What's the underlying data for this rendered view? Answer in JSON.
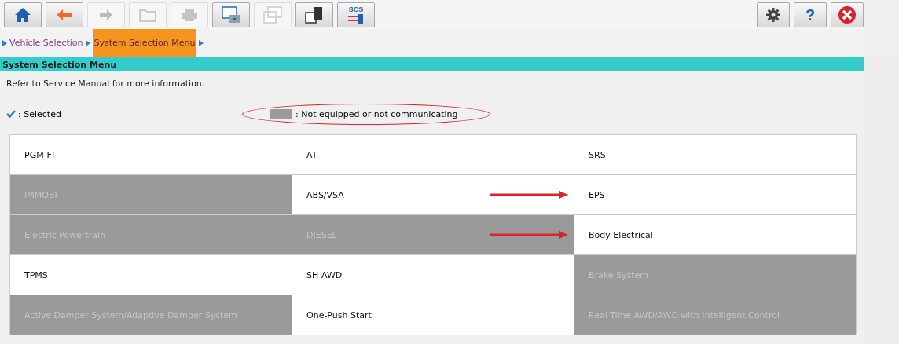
{
  "toolbar": {
    "left": [
      {
        "kind": "home",
        "disabled": false
      },
      {
        "kind": "back",
        "disabled": false
      },
      {
        "kind": "forward",
        "disabled": true
      },
      {
        "kind": "folder",
        "disabled": true
      },
      {
        "kind": "print",
        "disabled": true
      },
      {
        "kind": "screen",
        "disabled": false
      },
      {
        "kind": "window",
        "disabled": true
      },
      {
        "kind": "copy",
        "disabled": false
      },
      {
        "kind": "scs",
        "disabled": false,
        "label": "SCS"
      }
    ],
    "right": [
      {
        "kind": "settings"
      },
      {
        "kind": "help",
        "label": "?"
      },
      {
        "kind": "close"
      }
    ]
  },
  "breadcrumb": [
    {
      "label": "Vehicle Selection",
      "selected": false
    },
    {
      "label": "System Selection Menu",
      "selected": true
    }
  ],
  "section": {
    "title": "System Selection Menu",
    "note": "Refer to Service Manual for more information."
  },
  "legend": {
    "selected_label": ": Selected",
    "unavailable_label": ": Not equipped or not communicating",
    "circled": true
  },
  "systems": [
    {
      "label": "PGM-FI",
      "equipped": true,
      "arrow": false
    },
    {
      "label": "AT",
      "equipped": true,
      "arrow": false
    },
    {
      "label": "SRS",
      "equipped": true,
      "arrow": false
    },
    {
      "label": "IMMOBI",
      "equipped": false,
      "arrow": false
    },
    {
      "label": "ABS/VSA",
      "equipped": true,
      "arrow": true
    },
    {
      "label": "EPS",
      "equipped": true,
      "arrow": false
    },
    {
      "label": "Electric Powertrain",
      "equipped": false,
      "arrow": false
    },
    {
      "label": "DIESEL",
      "equipped": false,
      "arrow": true
    },
    {
      "label": "Body Electrical",
      "equipped": true,
      "arrow": false
    },
    {
      "label": "TPMS",
      "equipped": true,
      "arrow": false
    },
    {
      "label": "SH-AWD",
      "equipped": true,
      "arrow": false
    },
    {
      "label": "Brake System",
      "equipped": false,
      "arrow": false
    },
    {
      "label": "Active Damper System/Adaptive Damper System",
      "equipped": false,
      "arrow": false
    },
    {
      "label": "One-Push Start",
      "equipped": true,
      "arrow": false
    },
    {
      "label": "Real Time AWD/AWD with Intelligent Control",
      "equipped": false,
      "arrow": false
    }
  ]
}
